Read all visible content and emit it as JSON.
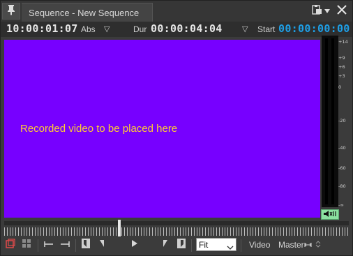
{
  "window": {
    "title": "Sequence - New Sequence"
  },
  "timecodes": {
    "current": "10:00:01:07",
    "current_mode": "Abs",
    "duration_label": "Dur",
    "duration": "00:00:04:04",
    "start_label": "Start",
    "start": "00:00:00:00"
  },
  "video": {
    "placeholder": "Recorded video to be placed here",
    "background_color": "#7700ff",
    "text_color": "#ffcc33"
  },
  "meter": {
    "scale": [
      "+14",
      "+9",
      "+6",
      "+3",
      "0",
      "-20",
      "-40",
      "-60",
      "-80",
      "-∞"
    ]
  },
  "toolbar": {
    "zoom_value": "Fit",
    "video_label": "Video",
    "master_label": "Master"
  },
  "colors": {
    "accent_timecode": "#1e9fe6",
    "mute_button": "#8be0a0"
  }
}
